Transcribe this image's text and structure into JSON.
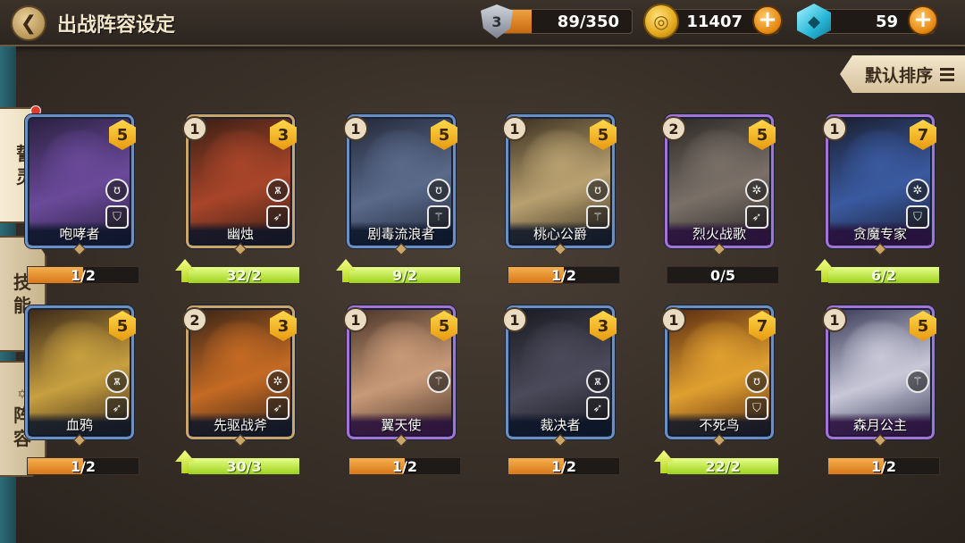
{
  "header": {
    "back_glyph": "❮",
    "title": "出战阵容设定",
    "stamina": {
      "level": "3",
      "value": "89/350",
      "fill_fraction": 0.25
    },
    "gold": {
      "value": "11407",
      "icon": "gold-coin-icon"
    },
    "gems": {
      "value": "59",
      "icon": "crystal-gem-icon"
    },
    "plus_glyph": "+"
  },
  "sort": {
    "label": "默认排序"
  },
  "tabs": [
    {
      "label_line1": "誓",
      "label_line2": "灵",
      "active": true,
      "dot": true
    },
    {
      "label_line1": "技",
      "label_line2": "能",
      "active": false,
      "dot": true
    },
    {
      "glyph": "✡",
      "label_line1": "阵",
      "label_line2": "容",
      "active": false,
      "dot": false
    }
  ],
  "colors": {
    "blue_frame": "#6a8fc4",
    "purple_frame": "#a274d8",
    "orange_bar": "#e08a28",
    "green_bar": "#b8e040"
  },
  "cards": [
    {
      "name": "咆哮者",
      "count": "",
      "stars": "5",
      "rarity": "blue",
      "progress": "1/2",
      "fill": 0.5,
      "bar": "orange",
      "upgrade": false,
      "icons": [
        "bear-icon",
        "shield-icon"
      ],
      "art": [
        "#6a4a9a",
        "#2b2040"
      ]
    },
    {
      "name": "幽烛",
      "count": "1",
      "stars": "3",
      "rarity": "bronze",
      "progress": "32/2",
      "fill": 1.0,
      "bar": "green",
      "upgrade": true,
      "icons": [
        "lion-icon",
        "bow-icon"
      ],
      "art": [
        "#a8452a",
        "#3a1e14"
      ]
    },
    {
      "name": "剧毒流浪者",
      "count": "1",
      "stars": "5",
      "rarity": "blue",
      "progress": "9/2",
      "fill": 1.0,
      "bar": "green",
      "upgrade": true,
      "icons": [
        "bear-icon",
        "staff-icon"
      ],
      "art": [
        "#5a6a8a",
        "#23283a"
      ]
    },
    {
      "name": "桃心公爵",
      "count": "1",
      "stars": "5",
      "rarity": "blue",
      "progress": "1/2",
      "fill": 0.5,
      "bar": "orange",
      "upgrade": false,
      "icons": [
        "bear-icon",
        "staff-icon"
      ],
      "art": [
        "#b8a070",
        "#3a3020"
      ]
    },
    {
      "name": "烈火战歌",
      "count": "2",
      "stars": "5",
      "rarity": "purple",
      "progress": "0/5",
      "fill": 0.0,
      "bar": "orange",
      "upgrade": false,
      "icons": [
        "gear-icon",
        "bow-icon"
      ],
      "art": [
        "#7a7068",
        "#2c2824"
      ]
    },
    {
      "name": "贪魔专家",
      "count": "1",
      "stars": "7",
      "rarity": "purple",
      "progress": "6/2",
      "fill": 1.0,
      "bar": "green",
      "upgrade": true,
      "icons": [
        "gear-icon",
        "shield-icon"
      ],
      "art": [
        "#3a5aa0",
        "#1a1e30"
      ]
    },
    {
      "name": "血鸦",
      "count": "",
      "stars": "5",
      "rarity": "blue",
      "progress": "1/2",
      "fill": 0.5,
      "bar": "orange",
      "upgrade": false,
      "icons": [
        "lion-icon",
        "bow-icon"
      ],
      "art": [
        "#c8a040",
        "#3a2818"
      ]
    },
    {
      "name": "先驱战斧",
      "count": "2",
      "stars": "3",
      "rarity": "bronze",
      "progress": "30/3",
      "fill": 1.0,
      "bar": "green",
      "upgrade": true,
      "icons": [
        "gear-icon",
        "bow-icon"
      ],
      "art": [
        "#c46a24",
        "#3a2416"
      ]
    },
    {
      "name": "翼天使",
      "count": "1",
      "stars": "5",
      "rarity": "purple",
      "progress": "1/2",
      "fill": 0.5,
      "bar": "orange",
      "upgrade": false,
      "icons": [
        "staff-icon"
      ],
      "art": [
        "#c89a78",
        "#4a3428"
      ]
    },
    {
      "name": "裁决者",
      "count": "1",
      "stars": "3",
      "rarity": "blue",
      "progress": "1/2",
      "fill": 0.5,
      "bar": "orange",
      "upgrade": false,
      "icons": [
        "lion-icon",
        "bow-icon"
      ],
      "art": [
        "#4a4a5a",
        "#1a1a22"
      ]
    },
    {
      "name": "不死鸟",
      "count": "1",
      "stars": "7",
      "rarity": "blue",
      "progress": "22/2",
      "fill": 1.0,
      "bar": "green",
      "upgrade": true,
      "icons": [
        "bear-icon",
        "shield-icon"
      ],
      "art": [
        "#e0a030",
        "#5a2a10"
      ]
    },
    {
      "name": "森月公主",
      "count": "1",
      "stars": "5",
      "rarity": "purple",
      "progress": "1/2",
      "fill": 0.5,
      "bar": "orange",
      "upgrade": false,
      "icons": [
        "staff-icon"
      ],
      "art": [
        "#c8c8d8",
        "#3a3a58"
      ]
    }
  ]
}
